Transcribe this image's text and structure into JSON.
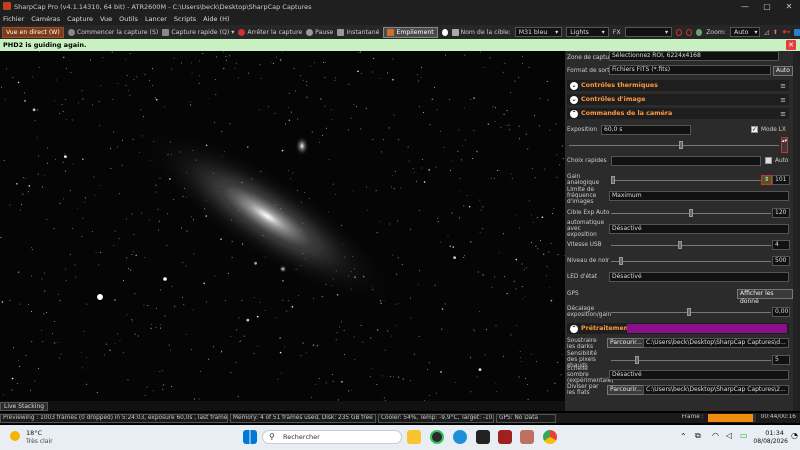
{
  "window": {
    "title": "SharpCap Pro (v4.1.14310, 64 bit) - ATR2600M - C:\\Users\\beck\\Desktop\\SharpCap Captures",
    "min": "—",
    "max": "▢",
    "close": "✕"
  },
  "menu": [
    "Fichier",
    "Caméras",
    "Capture",
    "Vue",
    "Outils",
    "Lancer",
    "Scripts",
    "Aide (H)"
  ],
  "toolbar": {
    "live_view": "Vue en direct (W)",
    "start_capture": "Commencer la capture (S)",
    "quick_capture": "Capture rapide (Q)",
    "stop_capture": "Arrêter la capture",
    "pause": "Pause",
    "snapshot": "Instantané",
    "stacking": "Empilement",
    "target_label": "Nom de la cible:",
    "target_value": "M31 bleu",
    "frame_type": "Lights",
    "fx_label": "FX",
    "zoom_label": "Zoom:",
    "zoom_value": "Auto"
  },
  "notification": {
    "text": "PHD2 is guiding again.",
    "close": "✕"
  },
  "panel": {
    "capture_area_label": "Zone de capture",
    "capture_area_value": "Sélectionnez ROI, 6224x4168",
    "output_format_label": "Format de sortie",
    "output_format_value": "Fichiers FITS (*.fits)",
    "output_format_btn": "Auto",
    "sections": {
      "thermal": "Contrôles thermiques",
      "image": "Contrôles d'image",
      "camera": "Commandes de la caméra",
      "preprocessing": "Prétraitement"
    },
    "exposure_label": "Exposition",
    "exposure_value": "60,0 s",
    "mode_lx_label": "Mode LX",
    "quick_choice_label": "Choix rapides",
    "quick_choice_auto": "Auto",
    "gain_label": "Gain analogique",
    "gain_value": "101",
    "frame_limit_label": "Limite de fréquence d'images",
    "frame_limit_value": "Maximum",
    "auto_exp_target_label": "Cible Exp Auto",
    "auto_exp_target_value": "120",
    "auto_with_exp_label": "automatique avec exposition",
    "auto_with_exp_value": "Désactivé",
    "usb_speed_label": "Vitesse USB",
    "usb_speed_value": "4",
    "black_level_label": "Niveau de noir",
    "black_level_value": "500",
    "led_label": "LED d'état",
    "led_value": "Désactivé",
    "gps_label": "GPS",
    "gps_btn": "Afficher les donné",
    "offset_label": "Décalage exposition/gain",
    "offset_value": "0,00",
    "subtract_dark_label": "Soustraire les darks",
    "browse": "Parcourir...",
    "dark_path": "C:\\Users\\beck\\Desktop\\SharpCap Captures\\d...",
    "hot_pixel_label": "Sensibilité des pixels chauds",
    "hot_pixel_value": "5",
    "dark_scale_label": "Échelle sombre (expérimentale)",
    "dark_scale_value": "Désactivé",
    "flats_label": "Diviser par les flats",
    "flats_path": "C:\\Users\\beck\\Desktop\\SharpCap Captures\\2..."
  },
  "live_stacking_btn": "Live Stacking",
  "status": {
    "preview": "Previewing : 1003 frames (0 dropped) in 5:24:03, exposure 60,0s , last frame 60,0s",
    "memory": "Memory: 4 of 51 frames used, Disk: 235 GB free",
    "cooler": "Cooler: 54%, Temp: -9,9°C, Target: -10,0°C",
    "gps": "GPS: No Data",
    "frame_label": "Frame :",
    "frame_progress": 0.95,
    "timer": "00:44/00:16"
  },
  "taskbar": {
    "temp": "18°C",
    "weather": "Très clair",
    "search": "Rechercher",
    "time": "01:34",
    "date": "08/08/2026"
  },
  "colors": {
    "accent": "#ff9a40",
    "stacking": "#7a3b1a",
    "notif": "#c8f0c0",
    "preproc": "#8a0f8a"
  }
}
